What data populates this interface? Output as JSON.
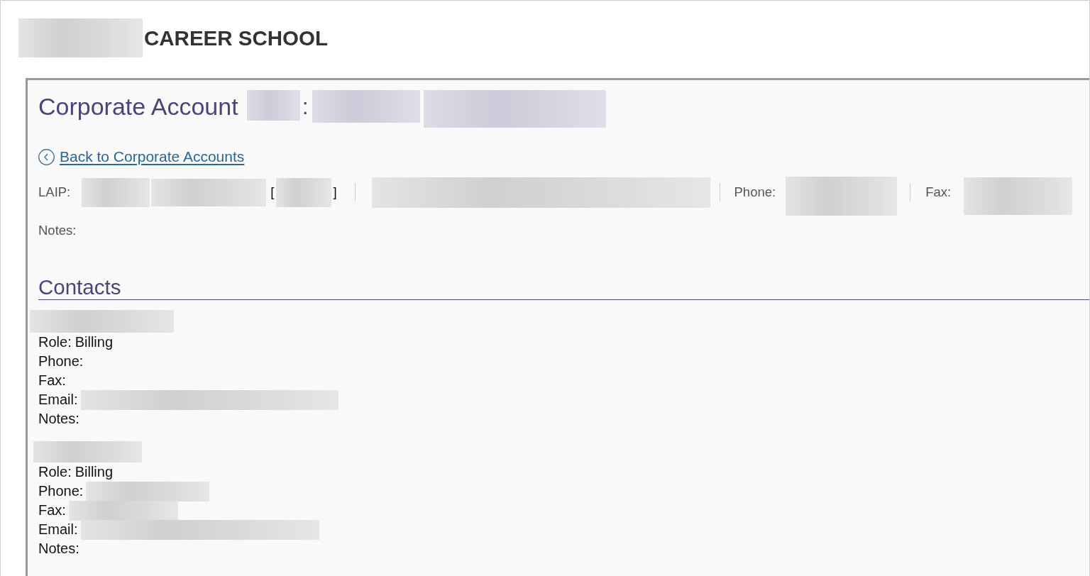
{
  "header": {
    "title": "CAREER SCHOOL"
  },
  "account": {
    "title": "Corporate Account",
    "separator": ":",
    "back_link": "Back to Corporate Accounts",
    "info_row": {
      "laip": {
        "label": "LAIP:",
        "bracket_open": "[",
        "bracket_close": "]"
      },
      "phone": {
        "label": "Phone:"
      },
      "fax": {
        "label": "Fax:"
      }
    },
    "notes": {
      "label": "Notes:"
    }
  },
  "contacts": {
    "heading": "Contacts",
    "items": [
      {
        "name_redacted": true,
        "fields": [
          {
            "label": "Role:",
            "value": "Billing",
            "redacted": false
          },
          {
            "label": "Phone:",
            "redacted": false
          },
          {
            "label": "Fax:",
            "redacted": false
          },
          {
            "label": "Email:",
            "redacted": true
          },
          {
            "label": "Notes:",
            "redacted": false
          }
        ]
      },
      {
        "name_redacted": true,
        "fields": [
          {
            "label": "Role:",
            "value": "Billing",
            "redacted": false
          },
          {
            "label": "Phone:",
            "redacted": true
          },
          {
            "label": "Fax:",
            "redacted": true
          },
          {
            "label": "Email:",
            "redacted": true
          },
          {
            "label": "Notes:",
            "redacted": false
          }
        ]
      }
    ]
  }
}
